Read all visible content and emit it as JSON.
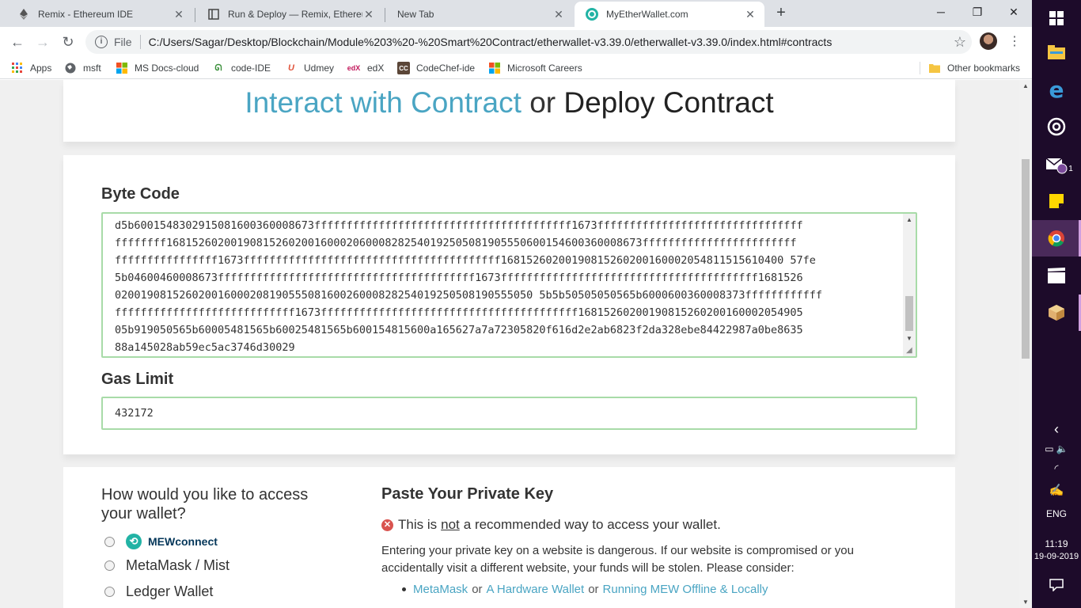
{
  "browser": {
    "tabs": [
      {
        "title": "Remix - Ethereum IDE",
        "icon": "ethereum-icon"
      },
      {
        "title": "Run & Deploy — Remix, Ethereum",
        "icon": "document-icon"
      },
      {
        "title": "New Tab",
        "icon": ""
      },
      {
        "title": "MyEtherWallet.com",
        "icon": "mew-icon"
      }
    ],
    "active_tab": 3,
    "new_tab": "+",
    "address": {
      "scheme_label": "File",
      "url": "C:/Users/Sagar/Desktop/Blockchain/Module%203%20-%20Smart%20Contract/etherwallet-v3.39.0/etherwallet-v3.39.0/index.html#contracts"
    },
    "bookmarks": [
      {
        "label": "Apps",
        "icon": "apps-grid-icon"
      },
      {
        "label": "msft",
        "icon": "globe-icon"
      },
      {
        "label": "MS Docs-cloud",
        "icon": "microsoft-icon"
      },
      {
        "label": "code-IDE",
        "icon": "code-icon"
      },
      {
        "label": "Udmey",
        "icon": "udemy-icon"
      },
      {
        "label": "edX",
        "icon": "edx-icon"
      },
      {
        "label": "CodeChef-ide",
        "icon": "codechef-icon"
      },
      {
        "label": "Microsoft Careers",
        "icon": "microsoft-icon"
      }
    ],
    "other_bookmarks": "Other bookmarks"
  },
  "page": {
    "heading": {
      "interact": "Interact with Contract",
      "or": "or",
      "deploy": "Deploy Contract"
    },
    "byte_code_label": "Byte Code",
    "byte_code": "d5b6001548302915081600360008673ffffffffffffffffffffffffffffffffffffffff1673ffffffffffffffffffffffffffffffffffffffff16815260200190815260200160002060008282540192505081905550600154600360008673ffffffffffffffffffffffffffffffffffffffff1673ffffffffffffffffffffffffffffffffffffffff16815260200190815260200160002054811515610400 57fe5b04600460008673ffffffffffffffffffffffffffffffffffffffff1673ffffffffffffffffffffffffffffffffffffffff168152602001908152602001600020819055508160026000828254019250508190555050 5b5b50505050565b6000600360008373ffffffffffffffffffffffffffffffffffffffff1673ffffffffffffffffffffffffffffffffffffffff16815260200190815260200160002054905 05b919050565b60005481565b60025481565b600154815600a165627a7a72305820f616d2e2ab6823f2da328ebe84422987a0be8635 88a145028ab59ec5ac3746d30029",
    "byte_code_lines": [
      "d5b6001548302915081600360008673ffffffffffffffffffffffffffffffffffffffff1673ffffffffffffffffffffffffffffffff",
      "ffffffff16815260200190815260200160002060008282540192505081905550600154600360008673ffffffffffffffffffffffff",
      "ffffffffffffffff1673ffffffffffffffffffffffffffffffffffffffff16815260200190815260200160002054811515610400 57fe",
      "5b04600460008673ffffffffffffffffffffffffffffffffffffffff1673ffffffffffffffffffffffffffffffffffffffff1681526",
      "02001908152602001600020819055508160026000828254019250508190555050 5b5b50505050565b6000600360008373ffffffffffff",
      "ffffffffffffffffffffffffffff1673ffffffffffffffffffffffffffffffffffffffff16815260200190815260200160002054905",
      "05b919050565b60005481565b60025481565b600154815600a165627a7a72305820f616d2e2ab6823f2da328ebe84422987a0be8635",
      "88a145028ab59ec5ac3746d30029"
    ],
    "gas_limit_label": "Gas Limit",
    "gas_limit_value": "432172",
    "access_question": "How would you like to access your wallet?",
    "access_options": [
      "MEWconnect",
      "MetaMask / Mist",
      "Ledger Wallet"
    ],
    "private_key_title": "Paste Your Private Key",
    "warning_pre": "This is",
    "warning_not": "not",
    "warning_post": "a recommended way to access your wallet.",
    "description": "Entering your private key on a website is dangerous. If our website is compromised or you accidentally visit a different website, your funds will be stolen. Please consider:",
    "suggestions": {
      "metamask": "MetaMask",
      "or1": "or",
      "hardware": "A Hardware Wallet",
      "or2": "or",
      "offline": "Running MEW Offline & Locally"
    }
  },
  "taskbar": {
    "time": "11:19",
    "date": "19-09-2019",
    "language": "ENG",
    "mail_badge": "1"
  },
  "colors": {
    "accent_link": "#4aa5c3",
    "input_border": "#a8dba8",
    "taskbar_bg": "#1d0b2a"
  }
}
